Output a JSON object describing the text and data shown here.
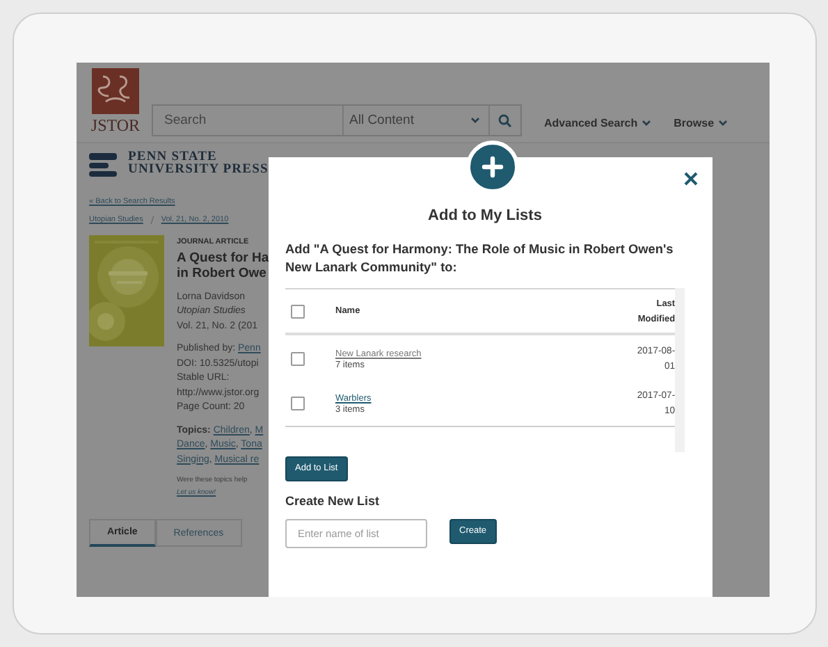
{
  "header": {
    "logo_text": "JSTOR",
    "search_placeholder": "Search",
    "scope": "All Content",
    "nav": [
      "Advanced Search",
      "Browse"
    ]
  },
  "publisher": [
    "PENN STATE",
    "UNIVERSITY PRESS"
  ],
  "back_link": "« Back to Search Results",
  "breadcrumbs": [
    "Utopian Studies",
    "Vol. 21, No. 2, 2010"
  ],
  "article": {
    "type": "JOURNAL ARTICLE",
    "title_lines": [
      "A Quest for Ha",
      "in Robert Owe"
    ],
    "author": "Lorna Davidson",
    "journal": "Utopian Studies",
    "issue": "Vol. 21, No. 2 (201",
    "published_label": "Published by: ",
    "publisher_link": "Penn",
    "doi": "DOI: 10.5325/utopi",
    "stable_label": "Stable URL:",
    "url": "http://www.jstor.org",
    "page_count": "Page Count: 20"
  },
  "topics": {
    "label": "Topics: ",
    "lines": [
      [
        "Children",
        ", ",
        "M"
      ],
      [
        "Dance",
        ", ",
        "Music",
        ", ",
        "Tona"
      ],
      [
        "Singing",
        ", ",
        "Musical re"
      ]
    ]
  },
  "feedback": {
    "question": "Were these topics help",
    "link": "Let us know!"
  },
  "tabs": [
    {
      "label": "Article",
      "selected": true
    },
    {
      "label": "References",
      "selected": false
    }
  ],
  "modal": {
    "title": "Add to My Lists",
    "prompt": "Add \"A Quest for Harmony: The Role of Music in Robert Owen's New Lanark Community\" to:",
    "columns": [
      "Name",
      "Last Modified"
    ],
    "select_all_checked": false,
    "rows": [
      {
        "name": "New Lanark research",
        "count": "7 items",
        "date": "2017-08-01",
        "checked": false,
        "visited": true
      },
      {
        "name": "Warblers",
        "count": "3 items",
        "date": "2017-07-10",
        "checked": false,
        "visited": false
      }
    ],
    "add_button": "Add to List",
    "create_heading": "Create New List",
    "create_placeholder": "Enter name of list",
    "create_button": "Create"
  }
}
